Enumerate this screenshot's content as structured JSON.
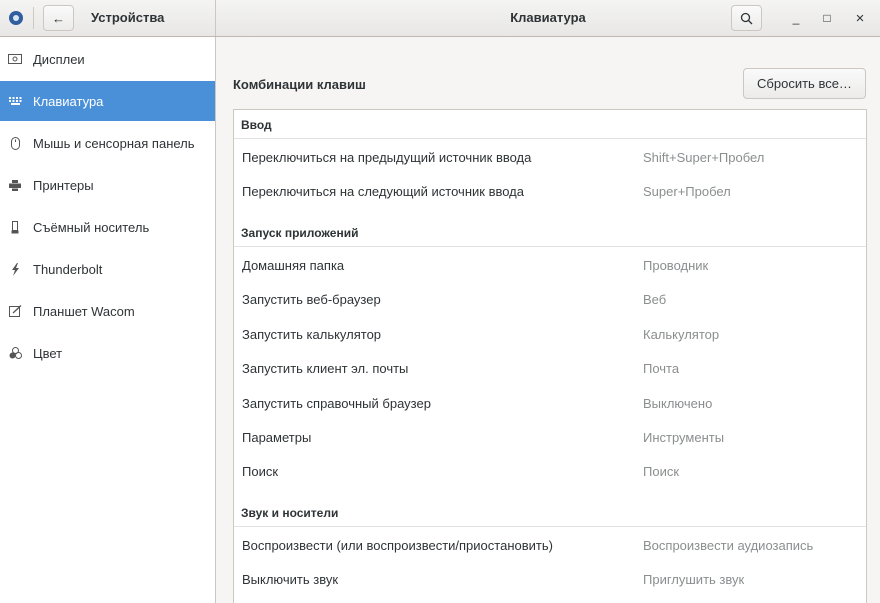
{
  "header": {
    "left_title": "Устройства",
    "center_title": "Клавиатура",
    "back_label": "←",
    "minimize_label": "_",
    "maximize_label": "□",
    "close_label": "×"
  },
  "sidebar": {
    "items": [
      {
        "label": "Дисплеи",
        "icon": "display-icon"
      },
      {
        "label": "Клавиатура",
        "icon": "keyboard-icon",
        "active": true
      },
      {
        "label": "Мышь и сенсорная панель",
        "icon": "mouse-icon"
      },
      {
        "label": "Принтеры",
        "icon": "printer-icon"
      },
      {
        "label": "Съёмный носитель",
        "icon": "usb-drive-icon"
      },
      {
        "label": "Thunderbolt",
        "icon": "thunderbolt-icon"
      },
      {
        "label": "Планшет Wacom",
        "icon": "tablet-icon"
      },
      {
        "label": "Цвет",
        "icon": "color-icon"
      }
    ]
  },
  "main": {
    "section_title": "Комбинации клавиш",
    "reset_button": "Сбросить все…",
    "categories": [
      {
        "name": "Ввод",
        "rows": [
          {
            "name": "Переключиться на предыдущий источник ввода",
            "key": "Shift+Super+Пробел"
          },
          {
            "name": "Переключиться на следующий источник ввода",
            "key": "Super+Пробел"
          }
        ]
      },
      {
        "name": "Запуск приложений",
        "rows": [
          {
            "name": "Домашняя папка",
            "key": "Проводник"
          },
          {
            "name": "Запустить веб-браузер",
            "key": "Веб"
          },
          {
            "name": "Запустить калькулятор",
            "key": "Калькулятор"
          },
          {
            "name": "Запустить клиент эл. почты",
            "key": "Почта"
          },
          {
            "name": "Запустить справочный браузер",
            "key": "Выключено"
          },
          {
            "name": "Параметры",
            "key": "Инструменты"
          },
          {
            "name": "Поиск",
            "key": "Поиск"
          }
        ]
      },
      {
        "name": "Звук и носители",
        "rows": [
          {
            "name": "Воспроизвести (или воспроизвести/приостановить)",
            "key": "Воспроизвести аудиозапись"
          },
          {
            "name": "Выключить звук",
            "key": "Приглушить звук"
          }
        ]
      }
    ]
  },
  "colors": {
    "accent": "#4a90d9",
    "shortcut_text": "#8b8e8f"
  }
}
